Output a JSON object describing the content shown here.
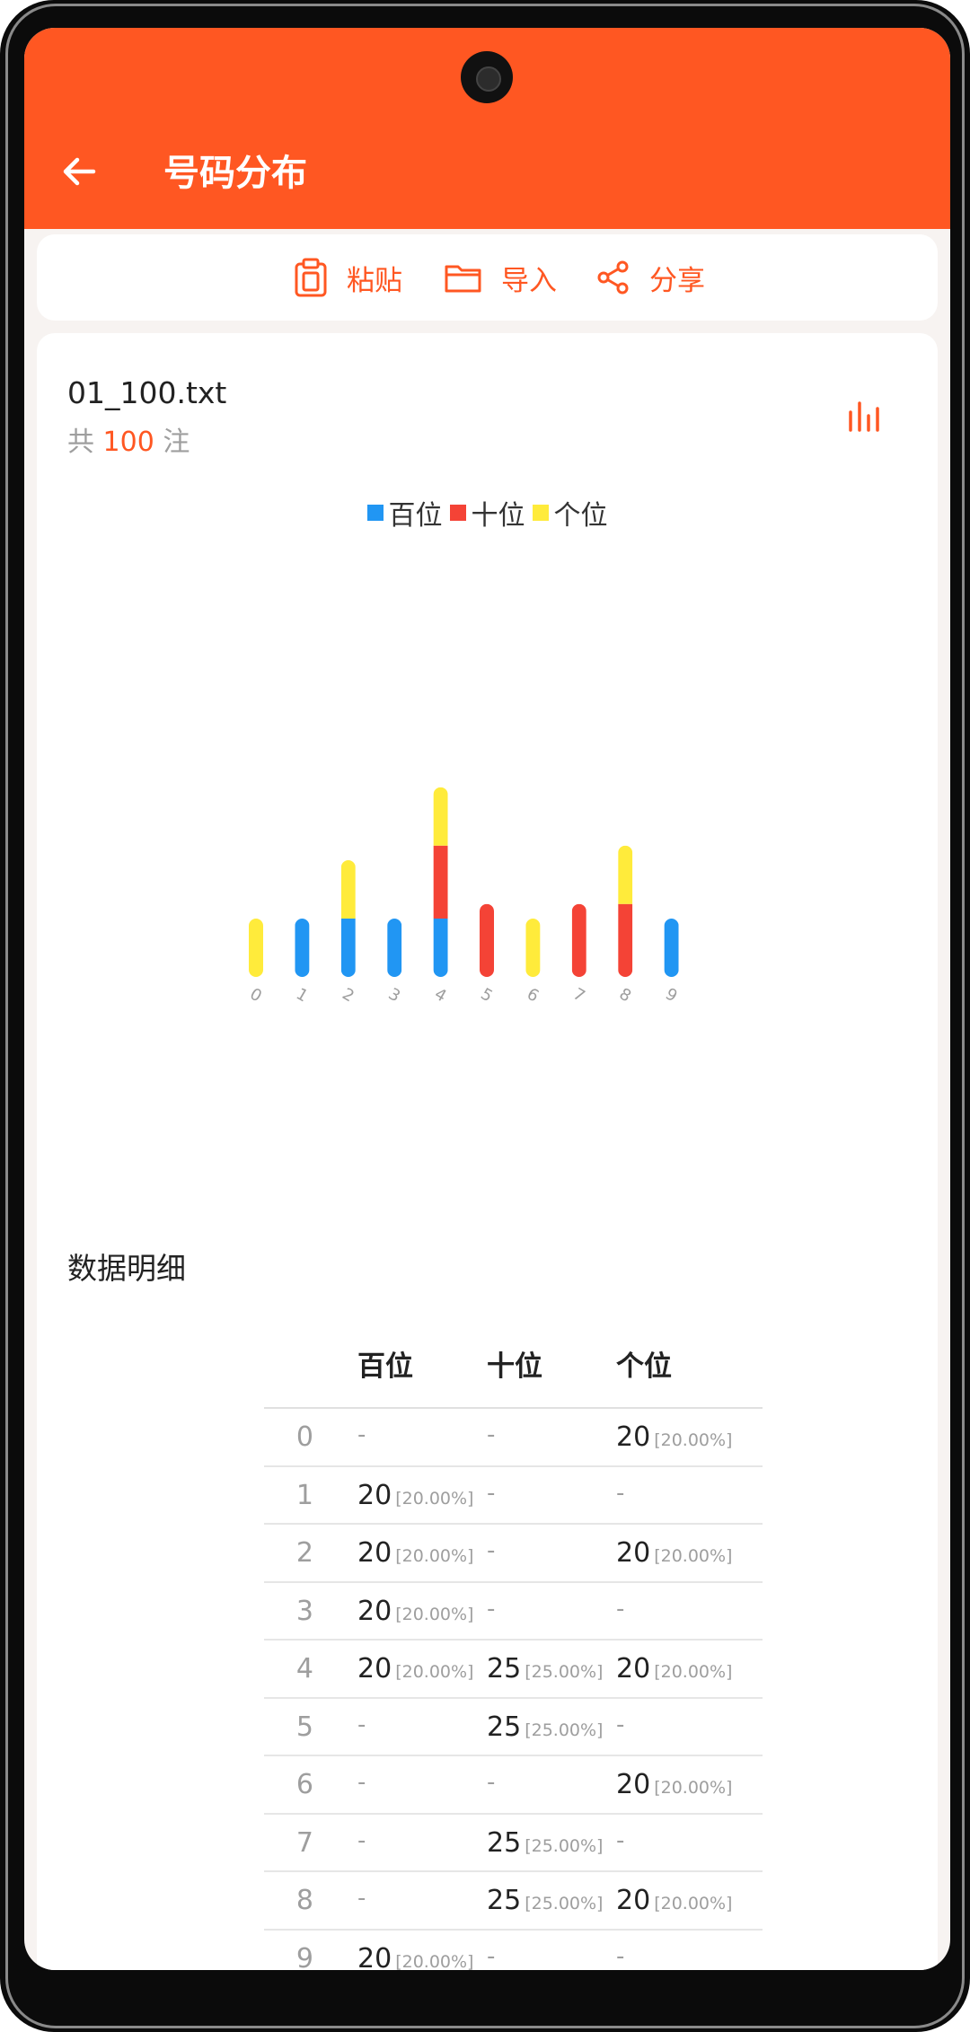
{
  "appbar": {
    "title": "号码分布"
  },
  "toolbar": {
    "paste_label": "粘贴",
    "import_label": "导入",
    "share_label": "分享"
  },
  "file": {
    "name": "01_100.txt",
    "count_prefix": "共",
    "count": "100",
    "count_suffix": "注"
  },
  "colors": {
    "accent": "#ff5722",
    "hundreds": "#2196f3",
    "tens": "#f44336",
    "ones": "#ffeb3b"
  },
  "chart_data": {
    "type": "bar",
    "stacked": true,
    "categories": [
      "0",
      "1",
      "2",
      "3",
      "4",
      "5",
      "6",
      "7",
      "8",
      "9"
    ],
    "series": [
      {
        "name": "百位",
        "color": "#2196f3",
        "values": [
          0,
          20,
          20,
          20,
          20,
          0,
          0,
          0,
          0,
          20
        ]
      },
      {
        "name": "十位",
        "color": "#f44336",
        "values": [
          0,
          0,
          0,
          0,
          25,
          25,
          0,
          25,
          25,
          0
        ]
      },
      {
        "name": "个位",
        "color": "#ffeb3b",
        "values": [
          20,
          0,
          20,
          0,
          20,
          0,
          20,
          0,
          20,
          0
        ]
      }
    ],
    "legend": "top-center",
    "grid": false
  },
  "detail": {
    "title": "数据明细",
    "headers": [
      "百位",
      "十位",
      "个位"
    ],
    "rows": [
      {
        "idx": "0",
        "cells": [
          {
            "v": "-",
            "p": ""
          },
          {
            "v": "-",
            "p": ""
          },
          {
            "v": "20",
            "p": "[20.00%]"
          }
        ]
      },
      {
        "idx": "1",
        "cells": [
          {
            "v": "20",
            "p": "[20.00%]"
          },
          {
            "v": "-",
            "p": ""
          },
          {
            "v": "-",
            "p": ""
          }
        ]
      },
      {
        "idx": "2",
        "cells": [
          {
            "v": "20",
            "p": "[20.00%]"
          },
          {
            "v": "-",
            "p": ""
          },
          {
            "v": "20",
            "p": "[20.00%]"
          }
        ]
      },
      {
        "idx": "3",
        "cells": [
          {
            "v": "20",
            "p": "[20.00%]"
          },
          {
            "v": "-",
            "p": ""
          },
          {
            "v": "-",
            "p": ""
          }
        ]
      },
      {
        "idx": "4",
        "cells": [
          {
            "v": "20",
            "p": "[20.00%]"
          },
          {
            "v": "25",
            "p": "[25.00%]"
          },
          {
            "v": "20",
            "p": "[20.00%]"
          }
        ]
      },
      {
        "idx": "5",
        "cells": [
          {
            "v": "-",
            "p": ""
          },
          {
            "v": "25",
            "p": "[25.00%]"
          },
          {
            "v": "-",
            "p": ""
          }
        ]
      },
      {
        "idx": "6",
        "cells": [
          {
            "v": "-",
            "p": ""
          },
          {
            "v": "-",
            "p": ""
          },
          {
            "v": "20",
            "p": "[20.00%]"
          }
        ]
      },
      {
        "idx": "7",
        "cells": [
          {
            "v": "-",
            "p": ""
          },
          {
            "v": "25",
            "p": "[25.00%]"
          },
          {
            "v": "-",
            "p": ""
          }
        ]
      },
      {
        "idx": "8",
        "cells": [
          {
            "v": "-",
            "p": ""
          },
          {
            "v": "25",
            "p": "[25.00%]"
          },
          {
            "v": "20",
            "p": "[20.00%]"
          }
        ]
      },
      {
        "idx": "9",
        "cells": [
          {
            "v": "20",
            "p": "[20.00%]"
          },
          {
            "v": "-",
            "p": ""
          },
          {
            "v": "-",
            "p": ""
          }
        ]
      }
    ]
  }
}
